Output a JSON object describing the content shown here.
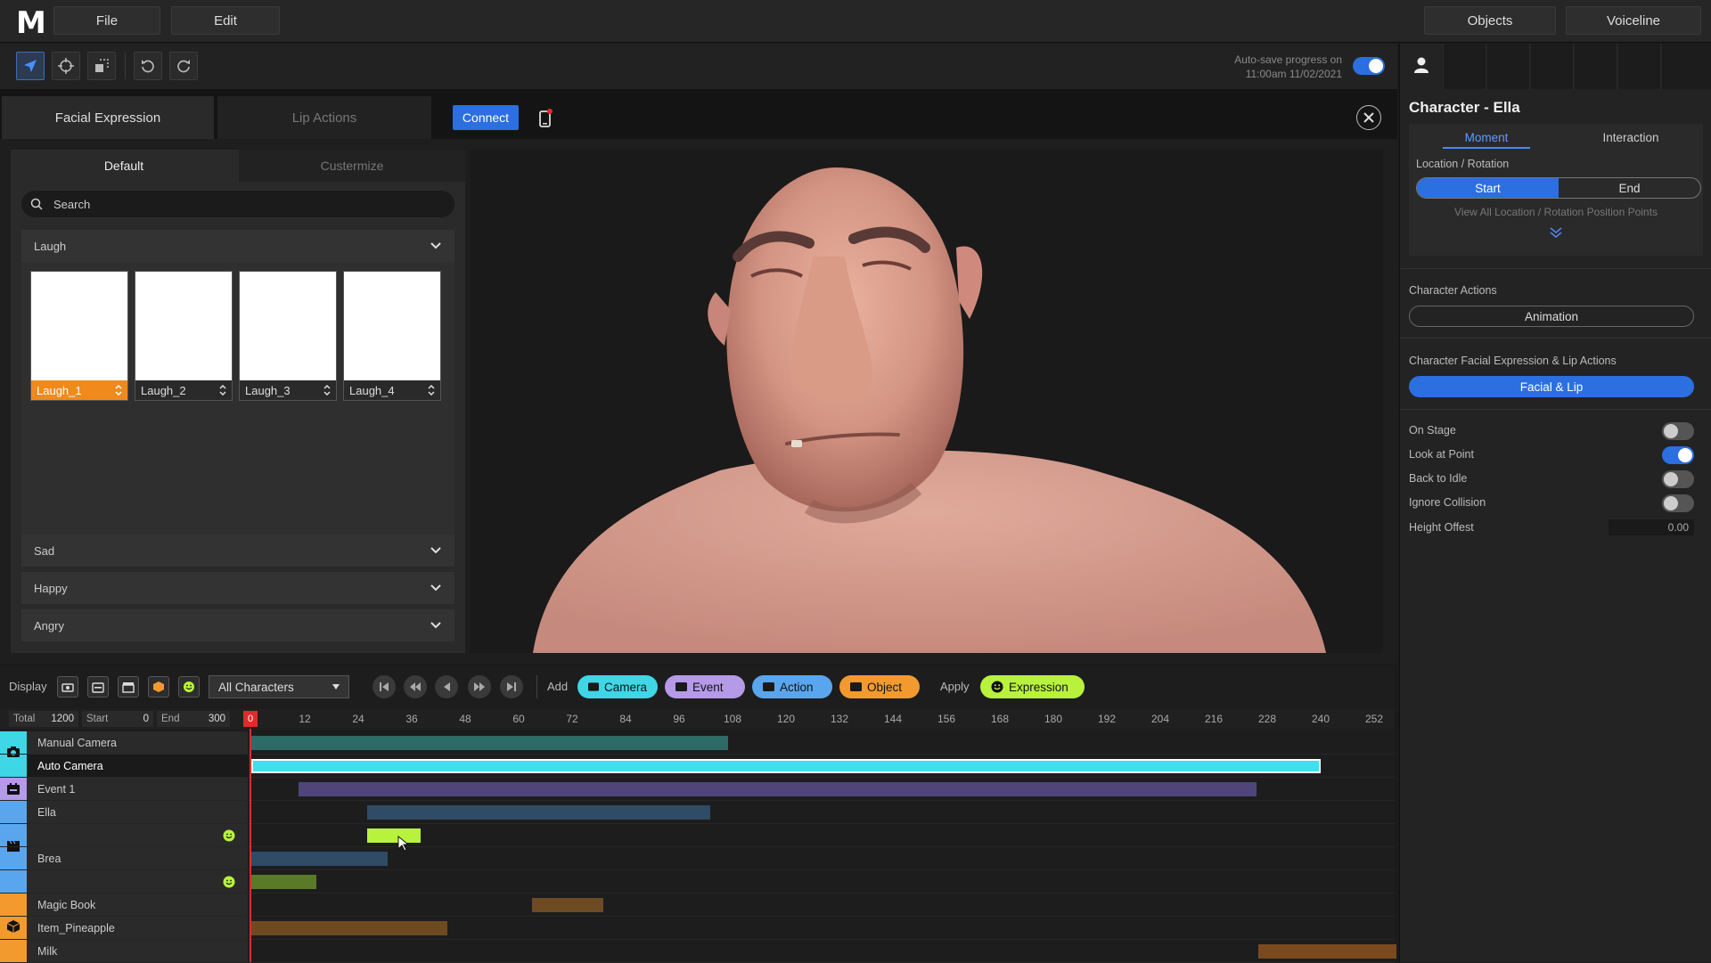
{
  "app": {
    "logo": "M"
  },
  "menu": {
    "file": "File",
    "edit": "Edit",
    "objects": "Objects",
    "voiceline": "Voiceline"
  },
  "toolbar": {
    "tools": [
      "select-arrow-icon",
      "move-crosshair-icon",
      "transform-icon",
      "undo-icon",
      "redo-icon"
    ],
    "autosave_line1": "Auto-save progress on",
    "autosave_line2": "11:00am 11/02/2021",
    "autosave_on": true
  },
  "editor": {
    "tabs": [
      "Facial Expression",
      "Lip Actions"
    ],
    "connect_label": "Connect",
    "library": {
      "subtabs": [
        "Default",
        "Custermize"
      ],
      "search_placeholder": "Search",
      "open_category": "Laugh",
      "thumbs": [
        "Laugh_1",
        "Laugh_2",
        "Laugh_3",
        "Laugh_4"
      ],
      "categories": [
        "Sad",
        "Happy",
        "Angry"
      ]
    }
  },
  "right_panel": {
    "title": "Character  -  Ella",
    "tabs": [
      "Moment",
      "Interaction"
    ],
    "location_label": "Location / Rotation",
    "segment": [
      "Start",
      "End"
    ],
    "view_all": "View All Location / Rotation Position Points",
    "character_actions_label": "Character Actions",
    "animation_button": "Animation",
    "facial_label": "Character Facial Expression & Lip Actions",
    "facial_button": "Facial & Lip",
    "toggles": [
      {
        "label": "On Stage",
        "on": false
      },
      {
        "label": "Look at Point",
        "on": true
      },
      {
        "label": "Back to Idle",
        "on": false
      },
      {
        "label": "Ignore Collision",
        "on": false
      }
    ],
    "height_offset_label": "Height Offest",
    "height_offset_value": "0.00"
  },
  "timeline": {
    "display_label": "Display",
    "display_icons": [
      "camera-icon",
      "event-icon",
      "clapper-icon",
      "box-icon",
      "smiley-icon"
    ],
    "character_filter": "All Characters",
    "add_label": "Add",
    "add_buttons": [
      {
        "label": "Camera",
        "color": "#3fd6e6"
      },
      {
        "label": "Event",
        "color": "#b59ae8"
      },
      {
        "label": "Action",
        "color": "#5aa6ee"
      },
      {
        "label": "Object",
        "color": "#f29a2e"
      }
    ],
    "apply_label": "Apply",
    "apply_button": {
      "label": "Expression",
      "color": "#b8f23c"
    },
    "total_label": "Total",
    "total_value": "1200",
    "start_label": "Start",
    "start_value": "0",
    "end_label": "End",
    "end_value": "300",
    "playhead": "0",
    "ticks": [
      "12",
      "24",
      "36",
      "48",
      "60",
      "72",
      "84",
      "96",
      "108",
      "120",
      "132",
      "144",
      "156",
      "168",
      "180",
      "192",
      "204",
      "216",
      "228",
      "240",
      "252"
    ],
    "rows": [
      {
        "label": "Manual Camera",
        "bar": [
          0,
          107
        ],
        "color": "#2e6a66",
        "group": "camera"
      },
      {
        "label": "Auto Camera",
        "bar": [
          0,
          240
        ],
        "color": "#3fe0f0",
        "group": "camera",
        "selected": true
      },
      {
        "label": "Event 1",
        "bar": [
          10.5,
          225.5
        ],
        "color": "#4f457a",
        "group": "event"
      },
      {
        "label": "Ella",
        "bar": [
          26,
          103
        ],
        "color": "#2f4b66",
        "group": "action"
      },
      {
        "label": "",
        "bar": [
          26,
          38
        ],
        "color": "#b8f23c",
        "group": "action",
        "icon": "smiley-icon"
      },
      {
        "label": "Brea",
        "bar": [
          0,
          30.5
        ],
        "color": "#2f4b66",
        "group": "action"
      },
      {
        "label": "",
        "bar": [
          0,
          14.5
        ],
        "color": "#5a7a2a",
        "group": "action",
        "icon": "smiley-icon"
      },
      {
        "label": "Magic Book",
        "bar": [
          63,
          79
        ],
        "color": "#6e4a22",
        "group": "object"
      },
      {
        "label": "Item_Pineapple",
        "bar": [
          0,
          44
        ],
        "color": "#6e4a22",
        "group": "object"
      },
      {
        "label": "Milk",
        "bar": [
          226,
          257
        ],
        "color": "#7a4a1f",
        "group": "object"
      }
    ]
  }
}
